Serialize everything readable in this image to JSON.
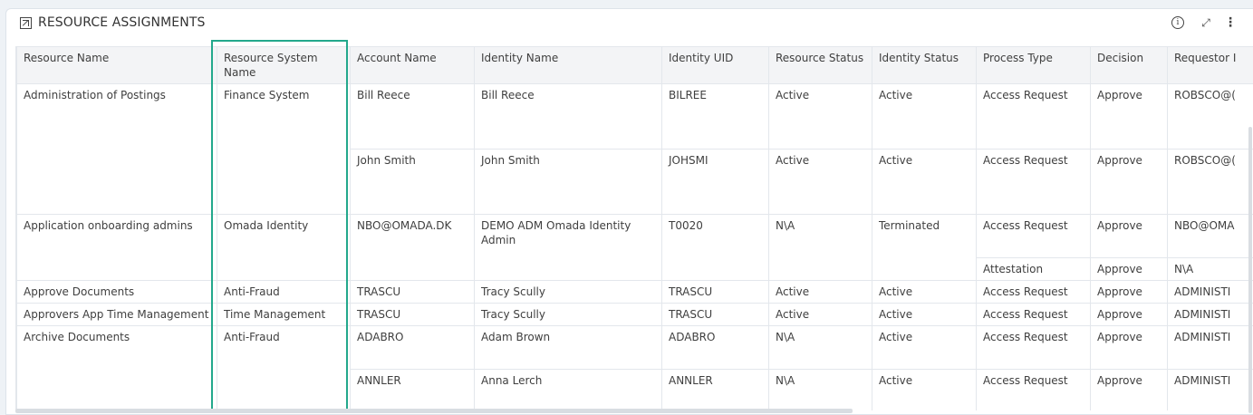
{
  "panel": {
    "title": "RESOURCE ASSIGNMENTS",
    "icons": [
      "external-link-icon",
      "info-icon",
      "expand-icon",
      "more-vertical-icon"
    ]
  },
  "table": {
    "columns": [
      "Resource Name",
      "Resource System Name",
      "Account Name",
      "Identity Name",
      "Identity UID",
      "Resource Status",
      "Identity Status",
      "Process Type",
      "Decision",
      "Requestor I"
    ],
    "rows": [
      {
        "resource": "Administration of Postings",
        "system": "Finance System",
        "account": "Bill Reece",
        "identity": "Bill Reece",
        "uid": "BILREE",
        "rstatus": "Active",
        "istatus": "Active",
        "process": "Access Request",
        "decision": "Approve",
        "requestor": "ROBSCO@("
      },
      {
        "resource": "",
        "system": "",
        "account": "John Smith",
        "identity": "John Smith",
        "uid": "JOHSMI",
        "rstatus": "Active",
        "istatus": "Active",
        "process": "Access Request",
        "decision": "Approve",
        "requestor": "ROBSCO@("
      },
      {
        "resource": "Application onboarding admins",
        "system": "Omada Identity",
        "account": "NBO@OMADA.DK",
        "identity": "DEMO ADM Omada Identity Admin",
        "uid": "T0020",
        "rstatus": "N\\A",
        "istatus": "Terminated",
        "process": "Access Request",
        "decision": "Approve",
        "requestor": "NBO@OMA"
      },
      {
        "resource": "",
        "system": "",
        "account": "",
        "identity": "",
        "uid": "",
        "rstatus": "",
        "istatus": "",
        "process": "Attestation",
        "decision": "Approve",
        "requestor": "N\\A"
      },
      {
        "resource": "Approve Documents",
        "system": "Anti-Fraud",
        "account": "TRASCU",
        "identity": "Tracy Scully",
        "uid": "TRASCU",
        "rstatus": "Active",
        "istatus": "Active",
        "process": "Access Request",
        "decision": "Approve",
        "requestor": "ADMINISTI"
      },
      {
        "resource": "Approvers App Time Management",
        "system": "Time Management",
        "account": "TRASCU",
        "identity": "Tracy Scully",
        "uid": "TRASCU",
        "rstatus": "Active",
        "istatus": "Active",
        "process": "Access Request",
        "decision": "Approve",
        "requestor": "ADMINISTI"
      },
      {
        "resource": "Archive Documents",
        "system": "Anti-Fraud",
        "account": "ADABRO",
        "identity": "Adam Brown",
        "uid": "ADABRO",
        "rstatus": "N\\A",
        "istatus": "Active",
        "process": "Access Request",
        "decision": "Approve",
        "requestor": "ADMINISTI"
      },
      {
        "resource": "",
        "system": "",
        "account": "ANNLER",
        "identity": "Anna Lerch",
        "uid": "ANNLER",
        "rstatus": "N\\A",
        "istatus": "Active",
        "process": "Access Request",
        "decision": "Approve",
        "requestor": "ADMINISTI"
      }
    ]
  },
  "colors": {
    "highlight": "#23a88c",
    "header_bg": "#f3f4f6",
    "border": "#e3e7ec"
  }
}
